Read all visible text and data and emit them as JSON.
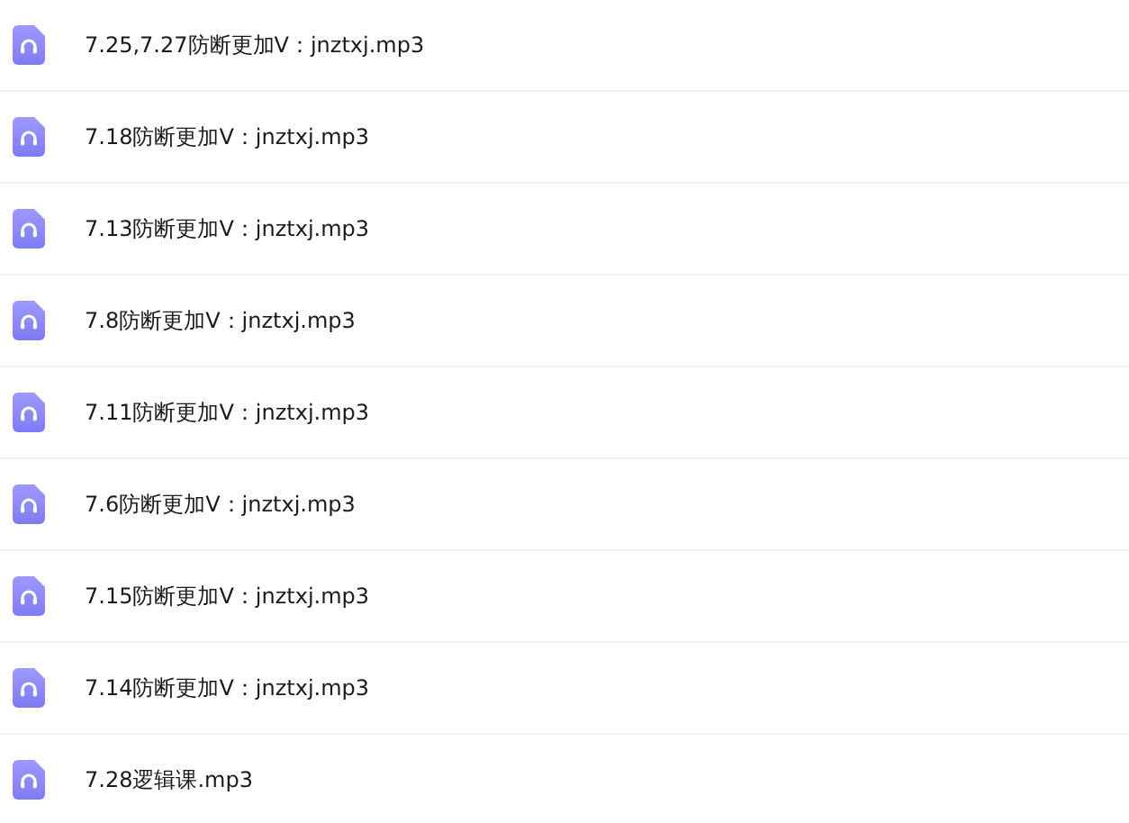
{
  "files": [
    {
      "name": "7.25,7.27防断更加V：jnztxj.mp3"
    },
    {
      "name": "7.18防断更加V：jnztxj.mp3"
    },
    {
      "name": "7.13防断更加V：jnztxj.mp3"
    },
    {
      "name": "7.8防断更加V：jnztxj.mp3"
    },
    {
      "name": "7.11防断更加V：jnztxj.mp3"
    },
    {
      "name": "7.6防断更加V：jnztxj.mp3"
    },
    {
      "name": "7.15防断更加V：jnztxj.mp3"
    },
    {
      "name": "7.14防断更加V：jnztxj.mp3"
    },
    {
      "name": "7.28逻辑课.mp3"
    }
  ]
}
